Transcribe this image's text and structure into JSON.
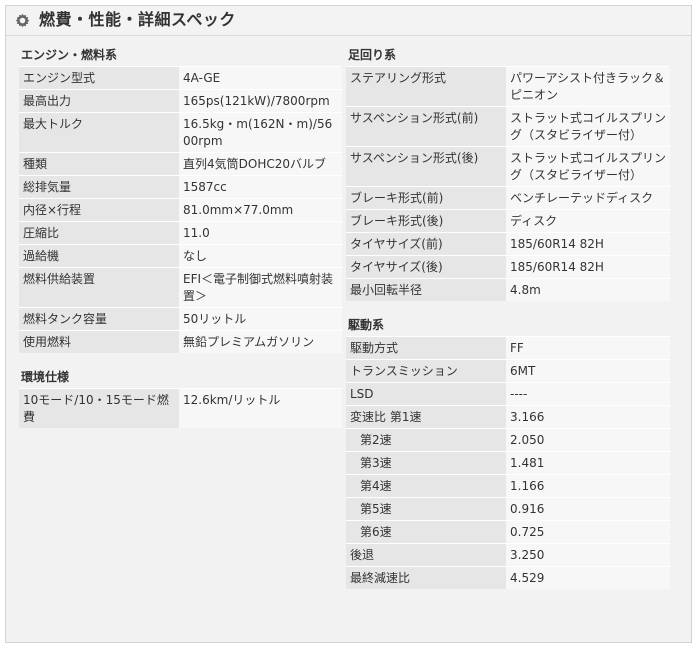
{
  "header": {
    "title": "燃費・性能・詳細スペック",
    "icon": "gear-icon"
  },
  "engine": {
    "title": "エンジン・燃料系",
    "rows": [
      {
        "k": "エンジン型式",
        "v": "4A-GE"
      },
      {
        "k": "最高出力",
        "v": "165ps(121kW)/7800rpm"
      },
      {
        "k": "最大トルク",
        "v": "16.5kg・m(162N・m)/5600rpm"
      },
      {
        "k": "種類",
        "v": "直列4気筒DOHC20バルブ"
      },
      {
        "k": "総排気量",
        "v": "1587cc"
      },
      {
        "k": "内径×行程",
        "v": "81.0mm×77.0mm"
      },
      {
        "k": "圧縮比",
        "v": "11.0"
      },
      {
        "k": "過給機",
        "v": "なし"
      },
      {
        "k": "燃料供給装置",
        "v": "EFI＜電子制御式燃料噴射装置＞"
      },
      {
        "k": "燃料タンク容量",
        "v": "50リットル"
      },
      {
        "k": "使用燃料",
        "v": "無鉛プレミアムガソリン"
      }
    ]
  },
  "env": {
    "title": "環境仕様",
    "rows": [
      {
        "k": "10モード/10・15モード燃費",
        "v": "12.6km/リットル"
      }
    ]
  },
  "chassis": {
    "title": "足回り系",
    "rows": [
      {
        "k": "ステアリング形式",
        "v": "パワーアシスト付きラック＆ピニオン"
      },
      {
        "k": "サスペンション形式(前)",
        "v": "ストラット式コイルスプリング（スタビライザー付）"
      },
      {
        "k": "サスペンション形式(後)",
        "v": "ストラット式コイルスプリング（スタビライザー付）"
      },
      {
        "k": "ブレーキ形式(前)",
        "v": "ベンチレーテッドディスク"
      },
      {
        "k": "ブレーキ形式(後)",
        "v": "ディスク"
      },
      {
        "k": "タイヤサイズ(前)",
        "v": "185/60R14 82H"
      },
      {
        "k": "タイヤサイズ(後)",
        "v": "185/60R14 82H"
      },
      {
        "k": "最小回転半径",
        "v": "4.8m"
      }
    ]
  },
  "drive": {
    "title": "駆動系",
    "rows": [
      {
        "k": "駆動方式",
        "v": "FF"
      },
      {
        "k": "トランスミッション",
        "v": "6MT"
      },
      {
        "k": "LSD",
        "v": "----"
      },
      {
        "k": "変速比 第1速",
        "v": "3.166"
      },
      {
        "k": "第2速",
        "v": "2.050"
      },
      {
        "k": "第3速",
        "v": "1.481"
      },
      {
        "k": "第4速",
        "v": "1.166"
      },
      {
        "k": "第5速",
        "v": "0.916"
      },
      {
        "k": "第6速",
        "v": "0.725"
      },
      {
        "k": "後退",
        "v": "3.250"
      },
      {
        "k": "最終減速比",
        "v": "4.529"
      }
    ]
  }
}
